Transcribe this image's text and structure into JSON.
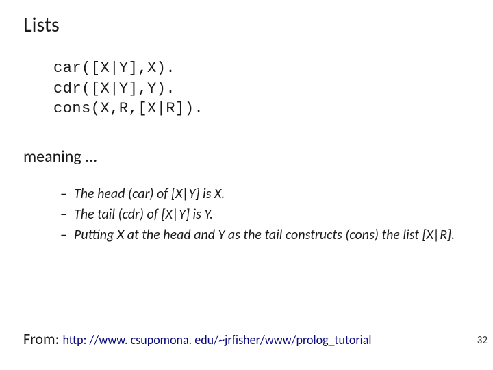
{
  "title": "Lists",
  "code": {
    "l1": "car([X|Y],X).",
    "l2": "cdr([X|Y],Y).",
    "l3": "cons(X,R,[X|R])."
  },
  "subhead": "meaning ...",
  "bullets": {
    "b1": "The head (car) of [X|Y] is X.",
    "b2": "The tail (cdr) of [X|Y] is Y.",
    "b3": "Putting X at the head and Y as the tail constructs (cons) the list [X|R]."
  },
  "footer": {
    "from_label": "From: ",
    "link_text": "http: //www. csupomona. edu/~jrfisher/www/prolog_tutorial"
  },
  "page_number": "32"
}
